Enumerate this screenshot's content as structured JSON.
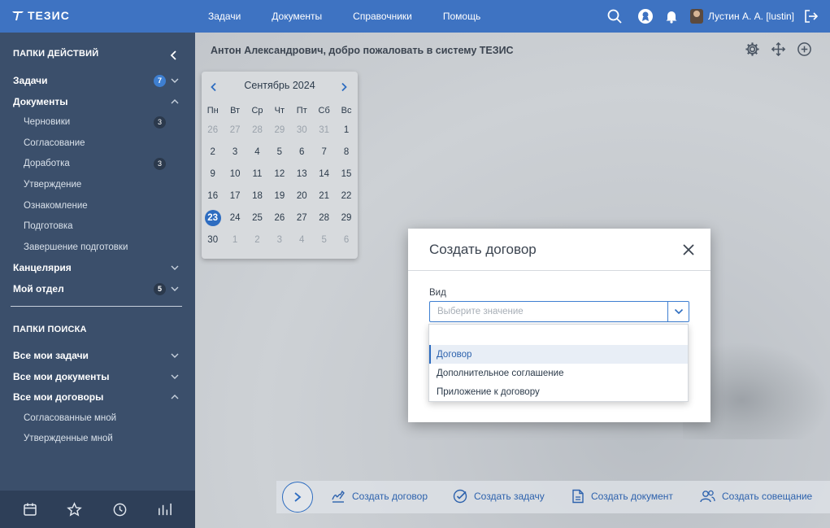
{
  "topbar": {
    "logo": "ТЕЗИС",
    "nav": [
      "Задачи",
      "Документы",
      "Справочники",
      "Помощь"
    ],
    "user": "Лустин А. А. [lustin]",
    "icons": [
      "search-icon",
      "award-icon",
      "bell-icon",
      "logout-icon"
    ]
  },
  "sidebar": {
    "actions_header": "ПАПКИ ДЕЙСТВИЙ",
    "tasks": {
      "label": "Задачи",
      "badge": "7"
    },
    "documents": {
      "label": "Документы"
    },
    "doc_items": [
      {
        "label": "Черновики",
        "badge": "3"
      },
      {
        "label": "Согласование",
        "badge": ""
      },
      {
        "label": "Доработка",
        "badge": "3"
      },
      {
        "label": "Утверждение",
        "badge": ""
      },
      {
        "label": "Ознакомление",
        "badge": ""
      },
      {
        "label": "Подготовка",
        "badge": ""
      },
      {
        "label": "Завершение подготовки",
        "badge": ""
      }
    ],
    "office": {
      "label": "Канцелярия"
    },
    "my_dept": {
      "label": "Мой отдел",
      "badge": "5"
    },
    "search_header": "ПАПКИ ПОИСКА",
    "all_tasks": "Все мои задачи",
    "all_docs": "Все мои документы",
    "all_contracts": "Все мои договоры",
    "contract_items": [
      "Согласованные мной",
      "Утвержденные мной"
    ],
    "bottom_icons": [
      "calendar-icon",
      "star-icon",
      "history-icon",
      "chart-icon"
    ]
  },
  "main": {
    "welcome": "Антон Александрович, добро пожаловать в систему ТЕЗИС",
    "tools": [
      "settings-icon",
      "move-icon",
      "add-icon"
    ]
  },
  "calendar": {
    "month": "Сентябрь 2024",
    "weekdays": [
      "Пн",
      "Вт",
      "Ср",
      "Чт",
      "Пт",
      "Сб",
      "Вс"
    ],
    "weeks": [
      [
        "26",
        "27",
        "28",
        "29",
        "30",
        "31",
        "1"
      ],
      [
        "2",
        "3",
        "4",
        "5",
        "6",
        "7",
        "8"
      ],
      [
        "9",
        "10",
        "11",
        "12",
        "13",
        "14",
        "15"
      ],
      [
        "16",
        "17",
        "18",
        "19",
        "20",
        "21",
        "22"
      ],
      [
        "23",
        "24",
        "25",
        "26",
        "27",
        "28",
        "29"
      ],
      [
        "30",
        "1",
        "2",
        "3",
        "4",
        "5",
        "6"
      ]
    ],
    "today": "23"
  },
  "actions": {
    "create_contract": "Создать договор",
    "create_task": "Создать задачу",
    "create_document": "Создать документ",
    "create_meeting": "Создать совещание"
  },
  "dialog": {
    "title": "Создать договор",
    "field_label": "Вид",
    "placeholder": "Выберите значение",
    "options": [
      "Договор",
      "Дополнительное соглашение",
      "Приложение к договору"
    ],
    "highlighted_option": "Договор",
    "colors": {
      "accent": "#2d6cc0",
      "topbar": "#3e73c2",
      "sidebar": "#3b4f6b"
    }
  }
}
